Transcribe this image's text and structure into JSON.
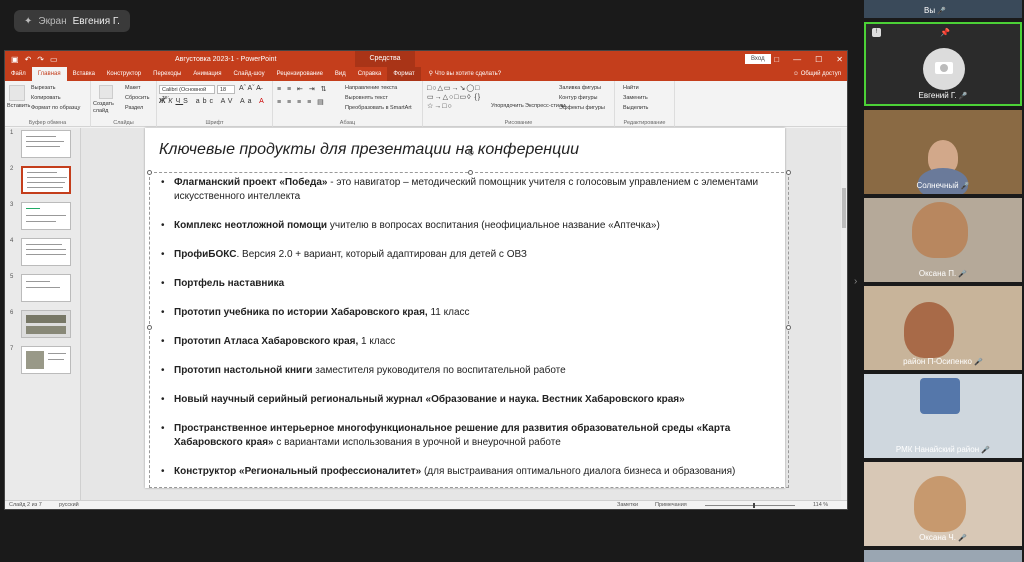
{
  "share_badge": {
    "screen_label": "Экран",
    "presenter": "Евгения Г."
  },
  "ppt": {
    "title": "Августовка 2023-1 - PowerPoint",
    "context_tab": "Средства рисования",
    "signin": "Вход",
    "tabs": [
      "Файл",
      "Главная",
      "Вставка",
      "Конструктор",
      "Переходы",
      "Анимация",
      "Слайд-шоу",
      "Рецензирование",
      "Вид",
      "Справка",
      "Формат"
    ],
    "tell_me": "Что вы хотите сделать?",
    "share": "Общий доступ",
    "ribbon": {
      "clipboard_group": "Буфер обмена",
      "paste": "Вставить",
      "cut": "Вырезать",
      "copy": "Копировать",
      "format_painter": "Формат по образцу",
      "slides_group": "Слайды",
      "new_slide": "Создать слайд",
      "layout": "Макет",
      "reset": "Сбросить",
      "section": "Раздел",
      "font_group": "Шрифт",
      "font_name": "Calibri (Основной те:",
      "font_size": "18",
      "paragraph_group": "Абзац",
      "text_direction": "Направление текста",
      "align_text": "Выровнять текст",
      "smartart": "Преобразовать в SmartArt",
      "drawing_group": "Рисование",
      "arrange": "Упорядочить",
      "quick_styles": "Экспресс-стили",
      "shape_fill": "Заливка фигуры",
      "shape_outline": "Контур фигуры",
      "shape_effects": "Эффекты фигуры",
      "editing_group": "Редактирование",
      "find": "Найти",
      "replace": "Заменить",
      "select": "Выделить"
    },
    "status": {
      "slide": "Слайд 2 из 7",
      "lang": "русский",
      "notes": "Заметки",
      "comments": "Примечания",
      "zoom": "114 %"
    }
  },
  "slide": {
    "title": "Ключевые продукты для презентации на конференции",
    "items": [
      {
        "bold": "Флагманский проект «Победа»",
        "rest": " - это навигатор – методический помощник учителя  с голосовым управлением с элементами искусственного интеллекта"
      },
      {
        "bold": "Комплекс неотложной помощи",
        "rest": " учителю в вопросах воспитания (неофициальное название «Аптечка»)"
      },
      {
        "bold": "ПрофиБОКС",
        "rest": ". Версия 2.0 + вариант, который адаптирован для детей с ОВЗ"
      },
      {
        "bold": "Портфель наставника",
        "rest": ""
      },
      {
        "bold": "Прототип учебника по истории Хабаровского края,",
        "rest": " 11 класс"
      },
      {
        "bold": "Прототип Атласа Хабаровского края,",
        "rest": " 1 класс"
      },
      {
        "bold": "Прототип настольной книги",
        "rest": " заместителя руководителя по воспитательной работе"
      },
      {
        "bold": "Новый научный серийный региональный журнал «Образование и наука. Вестник Хабаровского края»",
        "rest": ""
      },
      {
        "bold": "Пространственное интерьерное многофункциональное решение для развития образовательной среды «Карта Хабаровского края»",
        "rest": " с вариантами использования в урочной и внеурочной работе"
      },
      {
        "bold": "Конструктор «Региональный профессионалитет»",
        "rest": " (для выстраивания оптимального диалога бизнеса и образования)"
      }
    ]
  },
  "thumb_numbers": [
    "1",
    "2",
    "3",
    "4",
    "5",
    "6",
    "7"
  ],
  "participants": [
    {
      "name": "Вы"
    },
    {
      "name": "Евгений Г."
    },
    {
      "name": "Солнечный"
    },
    {
      "name": "Оксана П."
    },
    {
      "name": "район П-Осипенко"
    },
    {
      "name": "РМК Нанайский район"
    },
    {
      "name": "Оксана Ч."
    }
  ]
}
